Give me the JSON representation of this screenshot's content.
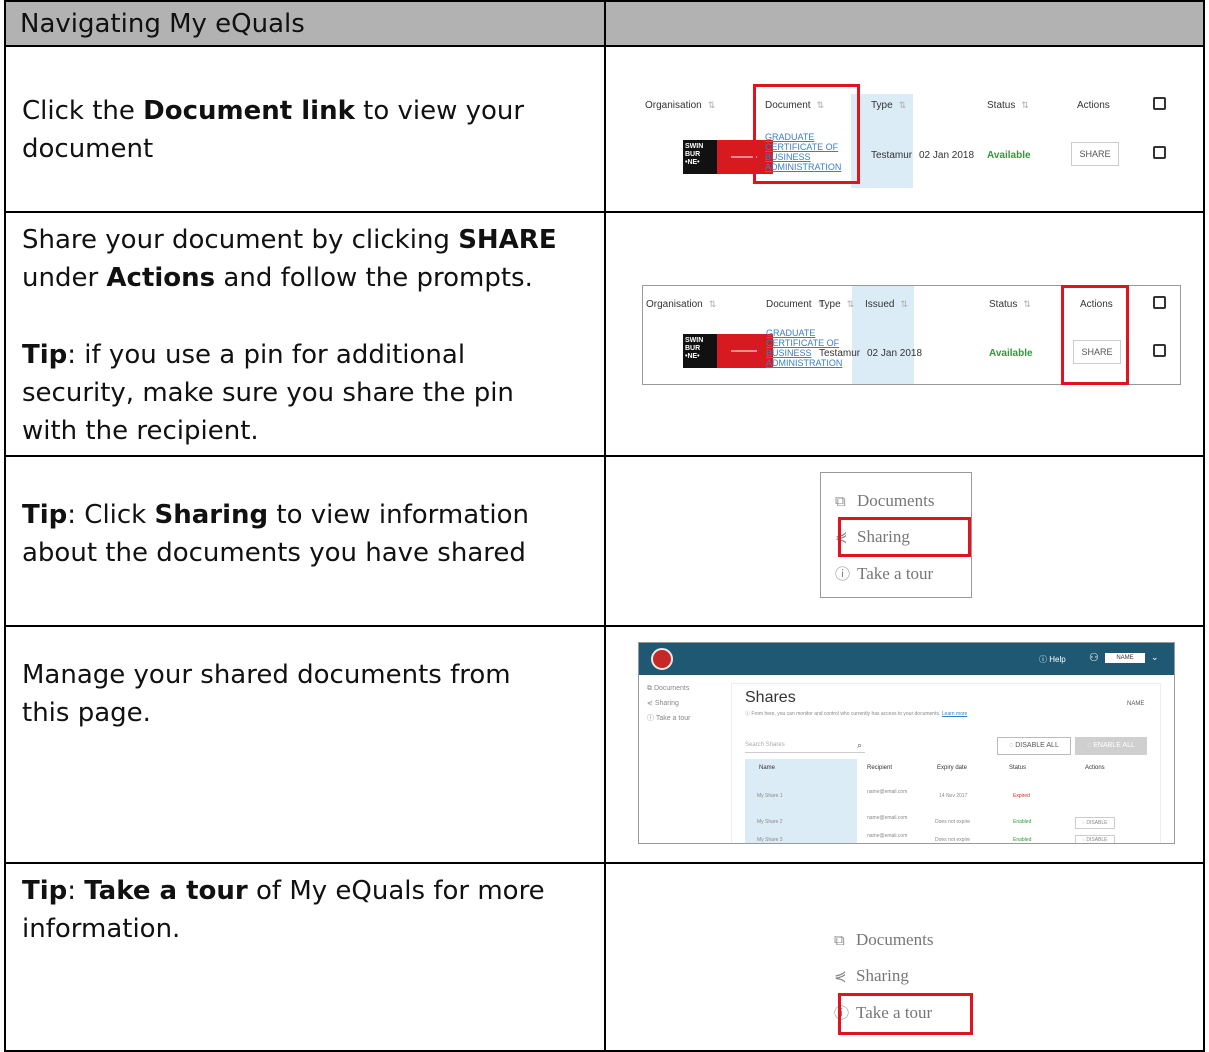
{
  "header": {
    "title": "Navigating My eQuals"
  },
  "rows": [
    {
      "parts": [
        {
          "text": "Click the ",
          "bold": false
        },
        {
          "text": "Document link",
          "bold": true
        },
        {
          "text": " to view your document",
          "bold": false
        }
      ]
    },
    {
      "parts": [
        {
          "text": "Share your document by clicking ",
          "bold": false
        },
        {
          "text": "SHARE",
          "bold": true
        },
        {
          "text": " under ",
          "bold": false
        },
        {
          "text": "Actions",
          "bold": true
        },
        {
          "text": " and follow the prompts.",
          "bold": false
        }
      ],
      "tip_parts": [
        {
          "text": "Tip",
          "bold": true
        },
        {
          "text": ": if you use a pin for additional security, make sure you share the pin with the recipient.",
          "bold": false
        }
      ]
    },
    {
      "parts": [
        {
          "text": "Tip",
          "bold": true
        },
        {
          "text": ": Click ",
          "bold": false
        },
        {
          "text": "Sharing",
          "bold": true
        },
        {
          "text": " to view information about the documents you have shared",
          "bold": false
        }
      ]
    },
    {
      "parts": [
        {
          "text": "Manage your shared documents from this page.",
          "bold": false
        }
      ]
    },
    {
      "parts": [
        {
          "text": "Tip",
          "bold": true
        },
        {
          "text": ": ",
          "bold": false
        },
        {
          "text": "Take a tour",
          "bold": true
        },
        {
          "text": " of My eQuals for more information.",
          "bold": false
        }
      ]
    }
  ],
  "doc_table": {
    "headers": {
      "organisation": "Organisation",
      "document": "Document",
      "type": "Type",
      "issued": "Issued",
      "status": "Status",
      "actions": "Actions"
    },
    "logo_lines": [
      "SWIN",
      "BUR",
      "•NE•"
    ],
    "document_lines": [
      "GRADUATE",
      "CERTIFICATE OF",
      "BUSINESS",
      "ADMINISTRATION"
    ],
    "type": "Testamur",
    "issued": "02 Jan 2018",
    "status": "Available",
    "action": "SHARE"
  },
  "menu": {
    "documents": "Documents",
    "sharing": "Sharing",
    "tour": "Take a tour"
  },
  "shares_page": {
    "help": "Help",
    "user": "NAME",
    "side": [
      "Documents",
      "Sharing",
      "Take a tour"
    ],
    "title": "Shares",
    "info": "From here, you can monitor and control who currently has access to your documents.",
    "learn_more": "Learn more",
    "name_btn": "NAME",
    "search_placeholder": "Search Shares",
    "disable_all": "DISABLE ALL",
    "enable_all": "ENABLE ALL",
    "columns": [
      "Name",
      "Recipient",
      "Expiry date",
      "Status",
      "Actions"
    ],
    "rows": [
      {
        "name": "My Share 1",
        "recipient": "name@email.com",
        "expiry": "14 Nov 2017",
        "status": "Expired",
        "action": ""
      },
      {
        "name": "My Share 2",
        "recipient": "name@email.com",
        "expiry": "Does not expire",
        "status": "Enabled",
        "action": "DISABLE"
      },
      {
        "name": "My Share 3",
        "recipient": "name@email.com",
        "expiry": "Does not expire",
        "status": "Enabled",
        "action": "DISABLE"
      }
    ]
  }
}
